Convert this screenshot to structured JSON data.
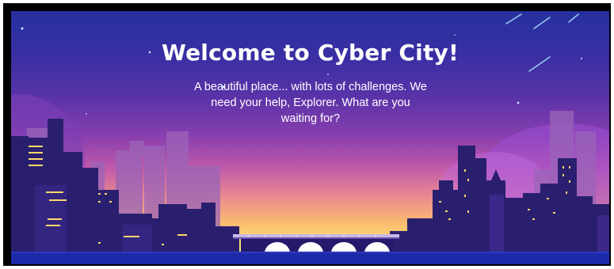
{
  "hero": {
    "title": "Welcome to Cyber City!",
    "subtitle": "A beautiful place... with lots of challenges. We need your help, Explorer. What are you waiting for?"
  },
  "colors": {
    "sky_top": "#26309e",
    "sky_mid": "#8a3fae",
    "horizon": "#fde07c",
    "building_dark": "#2a1f6e",
    "building_far": "#7a4fb0",
    "window_light": "#ffd86a",
    "water": "#1d2aa8"
  },
  "scene": {
    "illustration": "city-skyline-illustration",
    "bridge_icon": "bridge-icon",
    "shooting_star_icon": "shooting-star-icon"
  }
}
